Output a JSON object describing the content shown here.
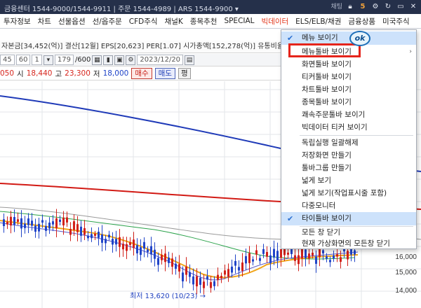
{
  "titlebar": {
    "text": "금융센터 1544-9000/1544-9911 | 주문 1544-4989 | ARS 1544-9900 ▾",
    "chat_label": "채팅",
    "icons": [
      "lock-icon",
      "notification-5-icon",
      "gear-icon",
      "refresh-icon",
      "window-icon",
      "close-icon"
    ]
  },
  "menubar": {
    "items": [
      "투자정보",
      "차트",
      "선물옵션",
      "선/옵주문",
      "CFD주식",
      "채널K",
      "종목추천",
      "SPECIAL",
      "빅데이터",
      "ELS/ELB/채권",
      "금융상품",
      "미국주식"
    ],
    "highlighted": "빅데이터",
    "highlight_color": "#e2361b"
  },
  "infobar": {
    "text": "자본금[34,452(억)] 결산[12월] EPS[20,623] PER[1.07] 시가총액[152,278(억)] 유통비율["
  },
  "toolbar": {
    "field_a": "45",
    "field_b": "60",
    "field_c": "1",
    "count": "179",
    "total": "/600",
    "date": "2023/12/20"
  },
  "pricebar": {
    "prev": "050",
    "open_label": "시",
    "open": "18,440",
    "high_label": "고",
    "high": "23,300",
    "low_label": "저",
    "low": "18,000",
    "buy": "매수",
    "sell": "매도",
    "avg": "평"
  },
  "chart_data": {
    "type": "line",
    "y_axis_labels": [
      "16,000",
      "15,000",
      "14,000"
    ],
    "low_annotation": "최저 13,620 (10/23)",
    "colors": {
      "ma_blue": "#1f3ab8",
      "ma_red": "#d21a14",
      "ma_gray": "#9a9a9a",
      "ma_green": "#2aa24a",
      "ma_orange": "#f0a51a",
      "candle_up": "#d2211a",
      "candle_down": "#2044c8"
    }
  },
  "context_menu": {
    "items": [
      {
        "label": "메뉴 보이기",
        "checked": true
      },
      {
        "label": "메뉴툴바 보이기",
        "checked": false
      },
      {
        "label": "화면툴바 보이기",
        "checked": false
      },
      {
        "label": "티커툴바 보이기",
        "checked": false
      },
      {
        "label": "차트툴바 보이기",
        "checked": false
      },
      {
        "label": "종목툴바 보이기",
        "checked": false
      },
      {
        "label": "쾌속주문툴바 보이기",
        "checked": false
      },
      {
        "label": "빅데이터 티커 보이기",
        "checked": false
      },
      {
        "label": "독립실행 일괄해제",
        "checked": false
      },
      {
        "label": "저장화면 만들기",
        "checked": false
      },
      {
        "label": "툴바그룹 만들기",
        "checked": false
      },
      {
        "label": "넓게 보기",
        "checked": false
      },
      {
        "label": "넓게 보기(작업표시줄 포함)",
        "checked": false
      },
      {
        "label": "다중모니터",
        "checked": false
      },
      {
        "label": "타이틀바 보이기",
        "checked": true
      },
      {
        "label": "모든 창 닫기",
        "checked": false
      },
      {
        "label": "현재 가상화면의 모든창 닫기",
        "checked": false
      }
    ],
    "ok_badge": "ok"
  }
}
